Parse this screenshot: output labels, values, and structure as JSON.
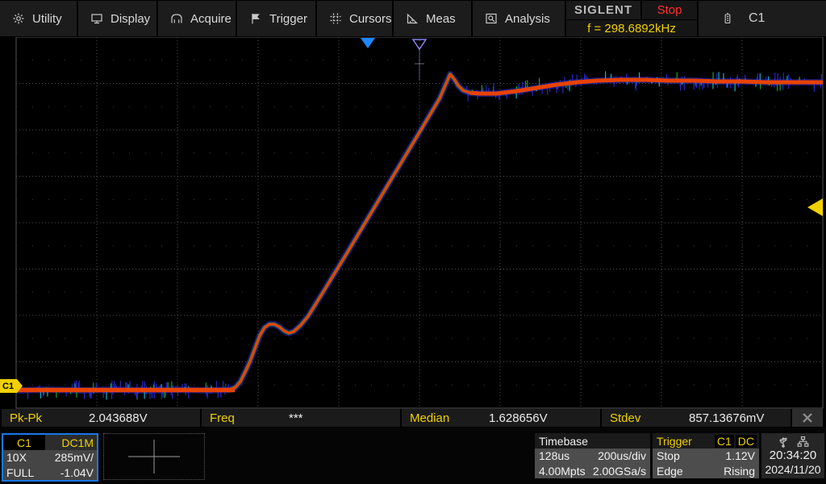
{
  "menu": {
    "items": [
      {
        "label": "Utility",
        "icon": "gear-icon"
      },
      {
        "label": "Display",
        "icon": "display-icon"
      },
      {
        "label": "Acquire",
        "icon": "acquire-icon"
      },
      {
        "label": "Trigger",
        "icon": "flag-icon"
      },
      {
        "label": "Cursors",
        "icon": "cursors-icon"
      },
      {
        "label": "Meas",
        "icon": "measure-triangle-icon"
      },
      {
        "label": "Analysis",
        "icon": "analysis-icon"
      }
    ]
  },
  "status": {
    "brand": "SIGLENT",
    "acq_status": "Stop",
    "freq_counter": "f = 298.6892kHz",
    "active_channel": "C1"
  },
  "measurements": {
    "items": [
      {
        "label": "Pk-Pk",
        "value": "2.043688V"
      },
      {
        "label": "Freq",
        "value": "***"
      },
      {
        "label": "Median",
        "value": "1.628656V"
      },
      {
        "label": "Stdev",
        "value": "857.13676mV"
      }
    ]
  },
  "channel": {
    "name": "C1",
    "coupling": "DC1M",
    "probe": "10X",
    "scale": "285mV/",
    "bandwidth": "FULL",
    "offset": "-1.04V"
  },
  "timebase": {
    "title": "Timebase",
    "delay": "128us",
    "scale": "200us/div",
    "mem_depth": "4.00Mpts",
    "sample_rate": "2.00GSa/s"
  },
  "trigger": {
    "title": "Trigger",
    "source": "C1",
    "coupling": "DC",
    "status": "Stop",
    "level": "1.12V",
    "type": "Edge",
    "slope": "Rising"
  },
  "clock": {
    "time": "20:34:20",
    "date": "2024/11/20"
  },
  "markers": {
    "channel_label": "C1"
  },
  "colors": {
    "accent_yellow": "#f0d000",
    "status_red": "#ff3030",
    "channel_border_blue": "#1778e8",
    "trigger_marker_blue": "#1e86ff",
    "trace_core": "#e84200",
    "trace_mid": "#1ab428",
    "trace_halo": "#2a2ee0",
    "grid": "#4f4f4f"
  }
}
